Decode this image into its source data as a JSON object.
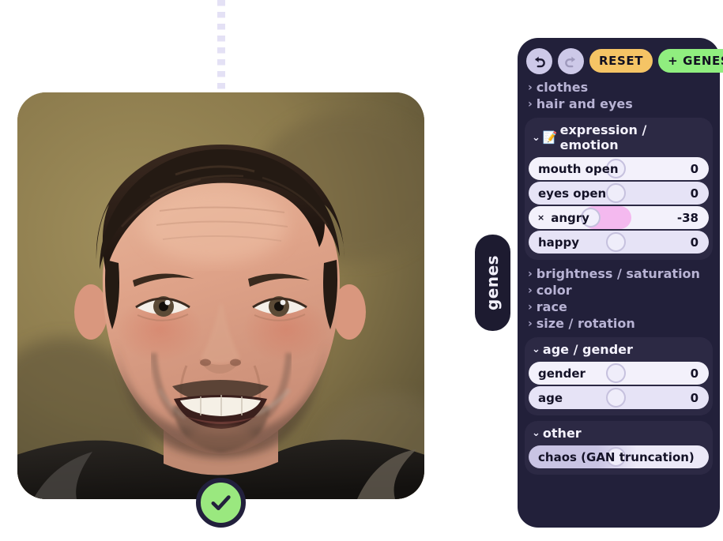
{
  "stage": {
    "guide": "dotted-vertical-guide",
    "confirm_button": {
      "icon": "check-icon",
      "label": ""
    },
    "portrait": {
      "alt": "generated male face portrait"
    }
  },
  "side_tab": {
    "label": "genes"
  },
  "panel": {
    "toolbar": {
      "undo": {
        "icon": "undo-arrow-icon",
        "label": ""
      },
      "redo": {
        "icon": "redo-arrow-icon",
        "label": ""
      },
      "reset_label": "RESET",
      "add_genes_label": "+ GENES"
    },
    "collapsed_top": [
      {
        "chevron": "›",
        "label": "clothes"
      },
      {
        "chevron": "›",
        "label": "hair and eyes"
      }
    ],
    "expression_section": {
      "chevron": "⌄",
      "emoji": "📝",
      "title": "expression / emotion",
      "sliders": [
        {
          "label": "mouth open",
          "value": "0",
          "knob_pct": 44,
          "fill_pct": 0,
          "removable": false,
          "tint": "tint-a"
        },
        {
          "label": "eyes open",
          "value": "0",
          "knob_pct": 44,
          "fill_pct": 0,
          "removable": false,
          "tint": "tint-b"
        },
        {
          "label": "angry",
          "value": "-38",
          "knob_pct": 30,
          "fill_pct": 57,
          "removable": true,
          "remove_label": "×",
          "tint": "tint-a"
        },
        {
          "label": "happy",
          "value": "0",
          "knob_pct": 44,
          "fill_pct": 0,
          "removable": false,
          "tint": "tint-b"
        }
      ]
    },
    "collapsed_middle": [
      {
        "chevron": "›",
        "label": "brightness / saturation"
      },
      {
        "chevron": "›",
        "label": "color"
      },
      {
        "chevron": "›",
        "label": "race"
      },
      {
        "chevron": "›",
        "label": "size / rotation"
      }
    ],
    "age_gender_section": {
      "chevron": "⌄",
      "title": "age / gender",
      "sliders": [
        {
          "label": "gender",
          "value": "0",
          "knob_pct": 44,
          "fill_pct": 0,
          "removable": false,
          "tint": "tint-a"
        },
        {
          "label": "age",
          "value": "0",
          "knob_pct": 44,
          "fill_pct": 0,
          "removable": false,
          "tint": "tint-b"
        }
      ]
    },
    "other_section": {
      "chevron": "⌄",
      "title": "other",
      "sliders": [
        {
          "label": "chaos (GAN truncation)",
          "value": "",
          "knob_pct": 44,
          "fill_pct": 0,
          "removable": false,
          "tint": "tint-grad"
        }
      ]
    }
  },
  "colors": {
    "panel_bg": "#22203a",
    "section_bg": "#2c2944",
    "accent_reset": "#f5c465",
    "accent_genes": "#90ee7f",
    "accent_slider_fill": "#f4b9ef",
    "confirm_green": "#9ae87f",
    "dark_ink": "#1d1b30"
  }
}
